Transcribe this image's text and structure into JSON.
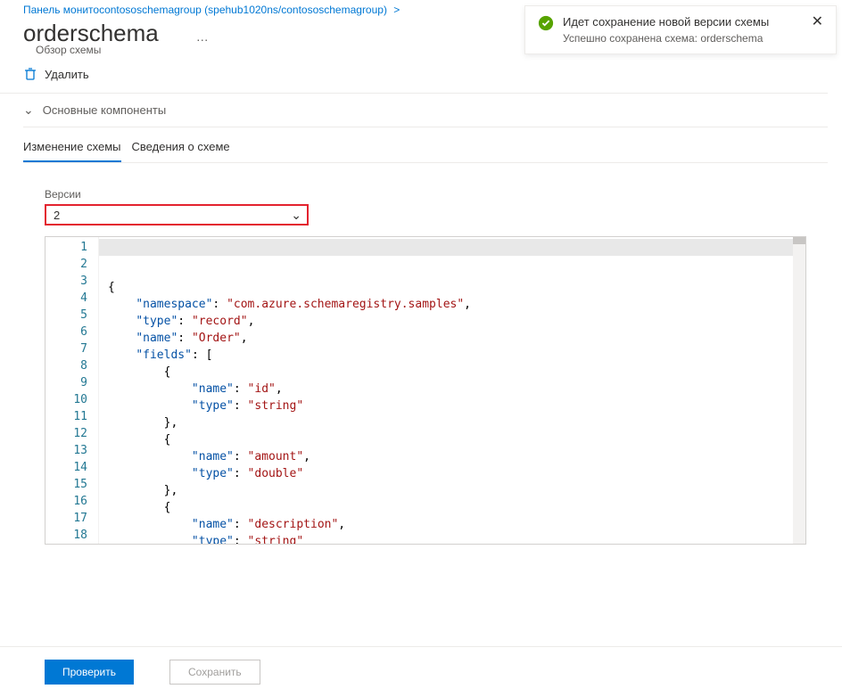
{
  "breadcrumb": {
    "prefix": "Панель монито",
    "link": "contososchemagroup (spehub1020ns/contososchemagroup)"
  },
  "page": {
    "title": "orderschema",
    "subtitle": "Обзор схемы",
    "dots": "…"
  },
  "toolbar": {
    "delete_label": "Удалить"
  },
  "essentials": {
    "label": "Основные компоненты"
  },
  "tabs": {
    "edit": "Изменение схемы",
    "details": "Сведения о схеме"
  },
  "version": {
    "label": "Версии",
    "selected": "2"
  },
  "code": {
    "lines": [
      1,
      2,
      3,
      4,
      5,
      6,
      7,
      8,
      9,
      10,
      11,
      12,
      13,
      14,
      15,
      16,
      17,
      18
    ],
    "schema": {
      "namespace": "com.azure.schemaregistry.samples",
      "type": "record",
      "name": "Order",
      "fields": [
        {
          "name": "id",
          "type": "string"
        },
        {
          "name": "amount",
          "type": "double"
        },
        {
          "name": "description",
          "type": "string"
        }
      ]
    }
  },
  "buttons": {
    "validate": "Проверить",
    "save": "Сохранить"
  },
  "toast": {
    "title": "Идет сохранение новой версии схемы",
    "message": "Успешно сохранена схема: orderschema"
  }
}
